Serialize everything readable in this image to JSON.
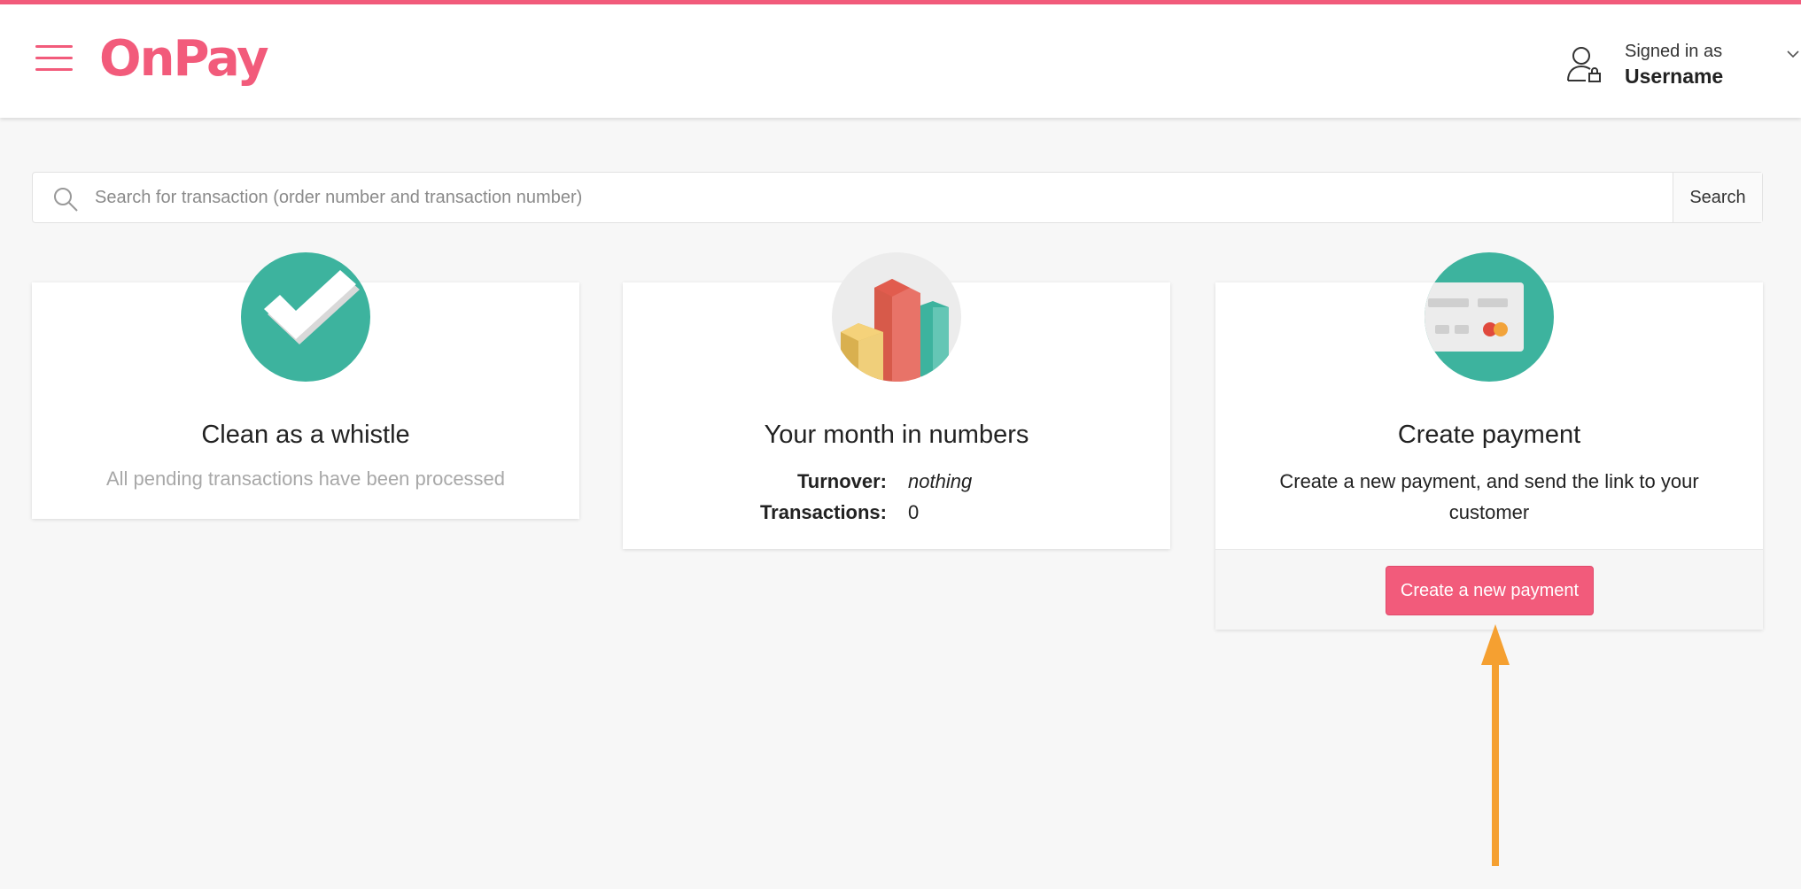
{
  "header": {
    "logo": "OnPay",
    "signed_in_label": "Signed in as",
    "username": "Username",
    "menu_icon": "hamburger-menu-icon",
    "user_icon": "user-lock-icon"
  },
  "search": {
    "placeholder": "Search for transaction (order number and transaction number)",
    "button_label": "Search"
  },
  "cards": [
    {
      "icon": "checkmark-icon",
      "title": "Clean as a whistle",
      "subtitle": "All pending transactions have been processed"
    },
    {
      "icon": "bar-chart-icon",
      "title": "Your month in numbers",
      "stats": [
        {
          "label": "Turnover:",
          "value": "nothing"
        },
        {
          "label": "Transactions:",
          "value": "0"
        }
      ]
    },
    {
      "icon": "credit-card-icon",
      "title": "Create payment",
      "description": "Create a new payment, and send the link to your customer",
      "button_label": "Create a new payment"
    }
  ],
  "colors": {
    "brand": "#f25b7b",
    "teal": "#3db39e",
    "annotation_arrow": "#f5a031"
  }
}
